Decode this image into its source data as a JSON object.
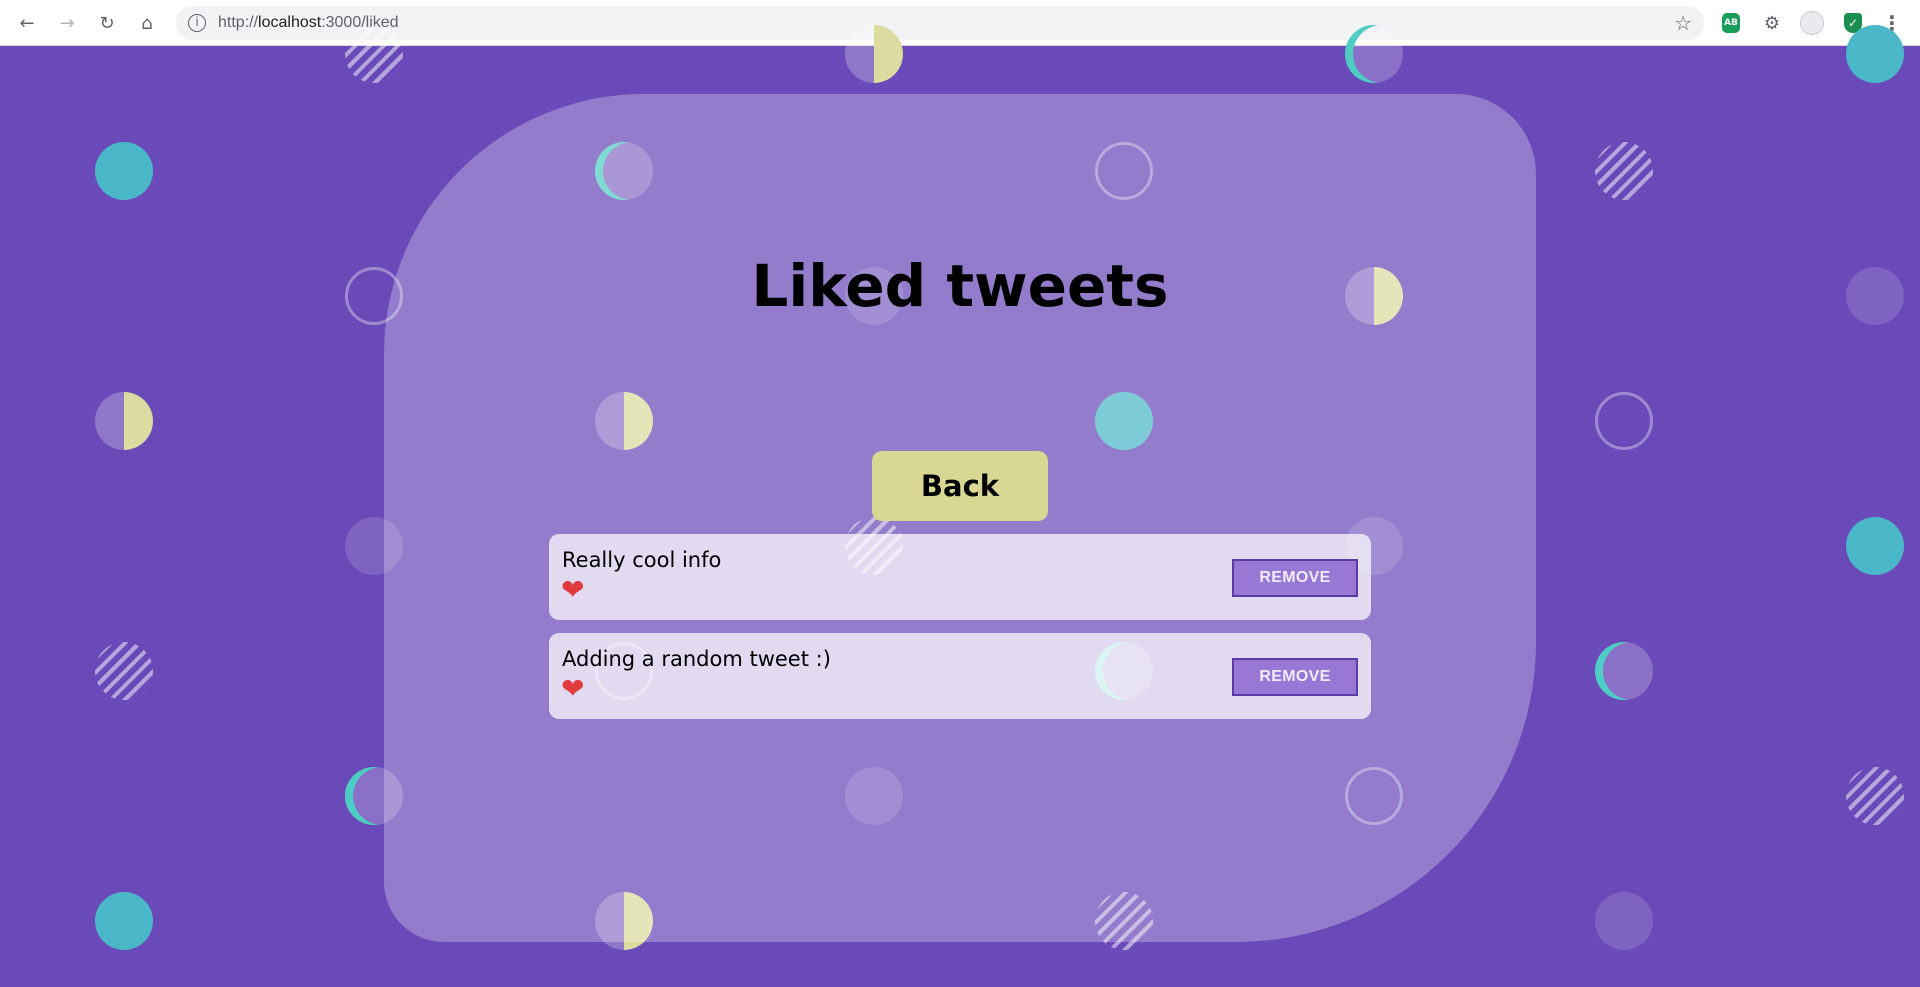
{
  "browser": {
    "url_scheme": "http://",
    "url_host": "localhost",
    "url_rest": ":3000/liked",
    "extensions": [
      "adblock-icon",
      "puzzle-icon",
      "profile-icon",
      "shield-icon",
      "menu-icon"
    ],
    "ext_ab_label": "AB"
  },
  "page": {
    "title": "Liked tweets",
    "back_label": "Back",
    "tweets": [
      {
        "text": "Really cool info",
        "liked": true,
        "remove_label": "REMOVE"
      },
      {
        "text": "Adding a random tweet :)",
        "liked": true,
        "remove_label": "REMOVE"
      }
    ]
  },
  "colors": {
    "background": "#6a4ab8",
    "accent_teal": "#4ab8c8",
    "back_button": "#d8d894",
    "remove_button": "#9878d4",
    "heart": "#e0393e"
  }
}
